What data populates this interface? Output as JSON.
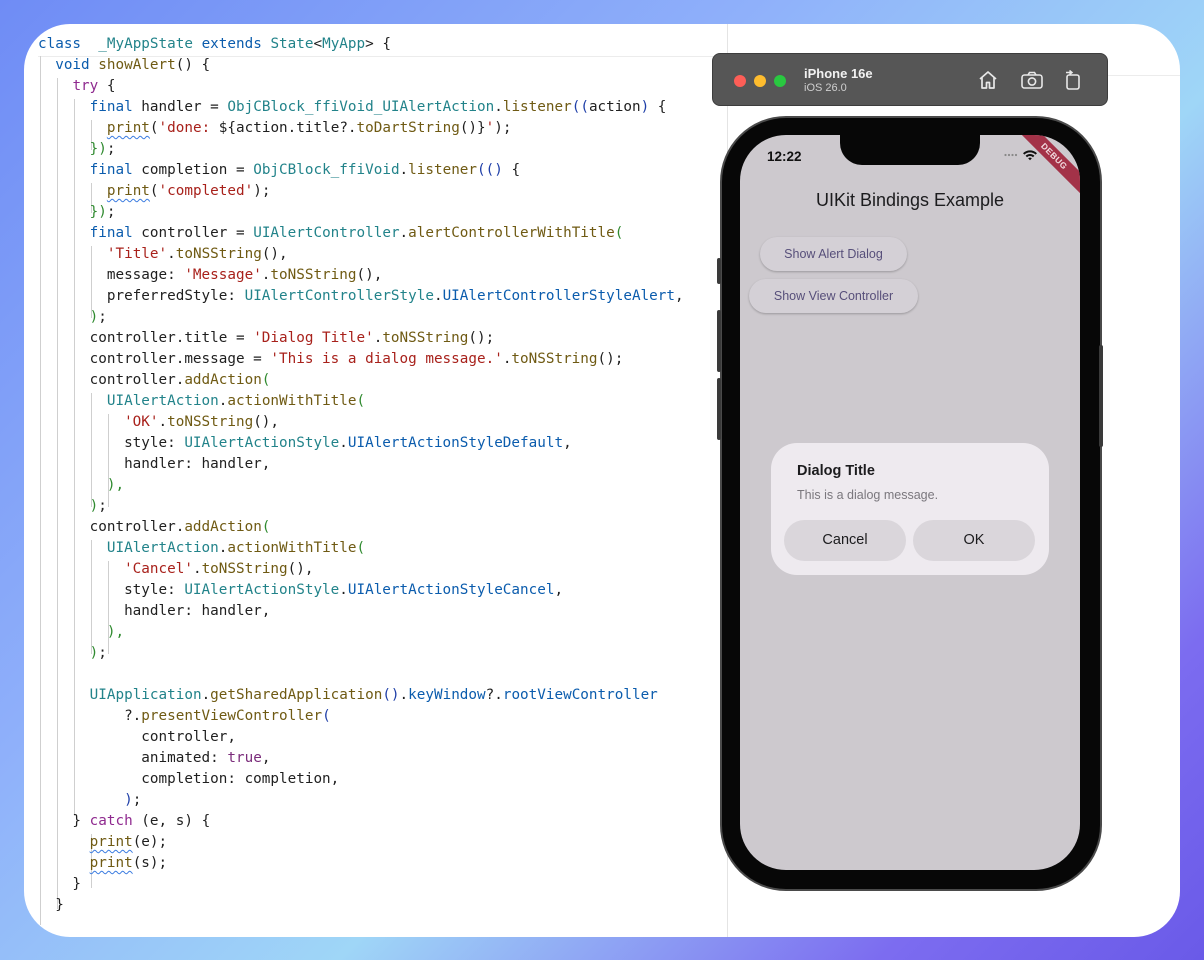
{
  "editor": {
    "lines": [
      [
        [
          "kw2",
          "class"
        ],
        [
          "",
          "  "
        ],
        [
          "ty",
          "_MyAppState"
        ],
        [
          "",
          " "
        ],
        [
          "kw2",
          "extends"
        ],
        [
          "",
          " "
        ],
        [
          "ty",
          "State"
        ],
        [
          "",
          "<"
        ],
        [
          "ty",
          "MyApp"
        ],
        [
          "",
          "> {"
        ]
      ],
      [
        [
          "",
          "  "
        ],
        [
          "kw2",
          "void"
        ],
        [
          "",
          " "
        ],
        [
          "fn",
          "showAlert"
        ],
        [
          "",
          "() {"
        ]
      ],
      [
        [
          "",
          "    "
        ],
        [
          "kw",
          "try"
        ],
        [
          "",
          " {"
        ]
      ],
      [
        [
          "",
          "      "
        ],
        [
          "kw2",
          "final"
        ],
        [
          "",
          " handler = "
        ],
        [
          "ty",
          "ObjCBlock_ffiVoid_UIAlertAction"
        ],
        [
          "",
          "."
        ],
        [
          "fn",
          "listener"
        ],
        [
          "br1",
          "(("
        ],
        [
          "",
          "action"
        ],
        [
          "br1",
          ")"
        ],
        [
          "",
          " {"
        ]
      ],
      [
        [
          "",
          "        "
        ],
        [
          "fn sq",
          "print"
        ],
        [
          "",
          "("
        ],
        [
          "st",
          "'done: "
        ],
        [
          "",
          "${action."
        ],
        [
          "",
          "title"
        ],
        [
          "",
          "?."
        ],
        [
          "fn",
          "toDartString"
        ],
        [
          "",
          "()}"
        ],
        [
          "st",
          "'"
        ],
        [
          "",
          ");"
        ]
      ],
      [
        [
          "",
          "      "
        ],
        [
          "br2",
          "})"
        ],
        [
          "",
          ";"
        ]
      ],
      [
        [
          "",
          "      "
        ],
        [
          "kw2",
          "final"
        ],
        [
          "",
          " completion = "
        ],
        [
          "ty",
          "ObjCBlock_ffiVoid"
        ],
        [
          "",
          "."
        ],
        [
          "fn",
          "listener"
        ],
        [
          "br1",
          "(()"
        ],
        [
          "",
          " {"
        ]
      ],
      [
        [
          "",
          "        "
        ],
        [
          "fn sq",
          "print"
        ],
        [
          "",
          "("
        ],
        [
          "st",
          "'completed'"
        ],
        [
          "",
          ");"
        ]
      ],
      [
        [
          "",
          "      "
        ],
        [
          "br2",
          "})"
        ],
        [
          "",
          ";"
        ]
      ],
      [
        [
          "",
          "      "
        ],
        [
          "kw2",
          "final"
        ],
        [
          "",
          " controller = "
        ],
        [
          "ty",
          "UIAlertController"
        ],
        [
          "",
          "."
        ],
        [
          "fn",
          "alertControllerWithTitle"
        ],
        [
          "br2",
          "("
        ]
      ],
      [
        [
          "",
          "        "
        ],
        [
          "st",
          "'Title'"
        ],
        [
          "",
          "."
        ],
        [
          "fn",
          "toNSString"
        ],
        [
          "",
          "(),"
        ]
      ],
      [
        [
          "",
          "        message: "
        ],
        [
          "st",
          "'Message'"
        ],
        [
          "",
          "."
        ],
        [
          "fn",
          "toNSString"
        ],
        [
          "",
          "(),"
        ]
      ],
      [
        [
          "",
          "        preferredStyle: "
        ],
        [
          "ty",
          "UIAlertControllerStyle"
        ],
        [
          "",
          "."
        ],
        [
          "en",
          "UIAlertControllerStyleAlert"
        ],
        [
          "",
          ","
        ]
      ],
      [
        [
          "",
          "      "
        ],
        [
          "br2",
          ")"
        ],
        [
          "",
          ";"
        ]
      ],
      [
        [
          "",
          "      controller.title = "
        ],
        [
          "st",
          "'Dialog Title'"
        ],
        [
          "",
          "."
        ],
        [
          "fn",
          "toNSString"
        ],
        [
          "",
          "();"
        ]
      ],
      [
        [
          "",
          "      controller.message = "
        ],
        [
          "st",
          "'This is a dialog message.'"
        ],
        [
          "",
          "."
        ],
        [
          "fn",
          "toNSString"
        ],
        [
          "",
          "();"
        ]
      ],
      [
        [
          "",
          "      controller."
        ],
        [
          "fn",
          "addAction"
        ],
        [
          "br2",
          "("
        ]
      ],
      [
        [
          "",
          "        "
        ],
        [
          "ty",
          "UIAlertAction"
        ],
        [
          "",
          "."
        ],
        [
          "fn",
          "actionWithTitle"
        ],
        [
          "br2",
          "("
        ]
      ],
      [
        [
          "",
          "          "
        ],
        [
          "st",
          "'OK'"
        ],
        [
          "",
          "."
        ],
        [
          "fn",
          "toNSString"
        ],
        [
          "",
          "(),"
        ]
      ],
      [
        [
          "",
          "          style: "
        ],
        [
          "ty",
          "UIAlertActionStyle"
        ],
        [
          "",
          "."
        ],
        [
          "en",
          "UIAlertActionStyleDefault"
        ],
        [
          "",
          ","
        ]
      ],
      [
        [
          "",
          "          handler: handler,"
        ]
      ],
      [
        [
          "",
          "        "
        ],
        [
          "br2",
          "),"
        ]
      ],
      [
        [
          "",
          "      "
        ],
        [
          "br2",
          ")"
        ],
        [
          "",
          ";"
        ]
      ],
      [
        [
          "",
          "      controller."
        ],
        [
          "fn",
          "addAction"
        ],
        [
          "br2",
          "("
        ]
      ],
      [
        [
          "",
          "        "
        ],
        [
          "ty",
          "UIAlertAction"
        ],
        [
          "",
          "."
        ],
        [
          "fn",
          "actionWithTitle"
        ],
        [
          "br2",
          "("
        ]
      ],
      [
        [
          "",
          "          "
        ],
        [
          "st",
          "'Cancel'"
        ],
        [
          "",
          "."
        ],
        [
          "fn",
          "toNSString"
        ],
        [
          "",
          "(),"
        ]
      ],
      [
        [
          "",
          "          style: "
        ],
        [
          "ty",
          "UIAlertActionStyle"
        ],
        [
          "",
          "."
        ],
        [
          "en",
          "UIAlertActionStyleCancel"
        ],
        [
          "",
          ","
        ]
      ],
      [
        [
          "",
          "          handler: handler,"
        ]
      ],
      [
        [
          "",
          "        "
        ],
        [
          "br2",
          "),"
        ]
      ],
      [
        [
          "",
          "      "
        ],
        [
          "br2",
          ")"
        ],
        [
          "",
          ";"
        ]
      ],
      [
        [
          "",
          ""
        ]
      ],
      [
        [
          "",
          "      "
        ],
        [
          "ty",
          "UIApplication"
        ],
        [
          "",
          "."
        ],
        [
          "fn",
          "getSharedApplication"
        ],
        [
          "br1",
          "()"
        ],
        [
          "",
          "."
        ],
        [
          "en",
          "keyWindow"
        ],
        [
          "",
          "?."
        ],
        [
          "en",
          "rootViewController"
        ]
      ],
      [
        [
          "",
          "          ?."
        ],
        [
          "fn",
          "presentViewController"
        ],
        [
          "br1",
          "("
        ]
      ],
      [
        [
          "",
          "            controller,"
        ]
      ],
      [
        [
          "",
          "            animated: "
        ],
        [
          "ok",
          "true"
        ],
        [
          "",
          ","
        ]
      ],
      [
        [
          "",
          "            completion: completion,"
        ]
      ],
      [
        [
          "",
          "          "
        ],
        [
          "br1",
          ")"
        ],
        [
          "",
          ";"
        ]
      ],
      [
        [
          "",
          "    } "
        ],
        [
          "kw",
          "catch"
        ],
        [
          "",
          " (e, s) {"
        ]
      ],
      [
        [
          "",
          "      "
        ],
        [
          "fn sq",
          "print"
        ],
        [
          "",
          "(e);"
        ]
      ],
      [
        [
          "",
          "      "
        ],
        [
          "fn sq",
          "print"
        ],
        [
          "",
          "(s);"
        ]
      ],
      [
        [
          "",
          "    }"
        ]
      ],
      [
        [
          "",
          "  }"
        ]
      ]
    ]
  },
  "simulator": {
    "device_name": "iPhone 16e",
    "os_version": "iOS 26.0",
    "status_time": "12:22",
    "debug_banner": "DEBUG",
    "app_title": "UIKit Bindings Example",
    "buttons": {
      "show_alert": "Show Alert Dialog",
      "show_view_controller": "Show View Controller"
    },
    "dialog": {
      "title": "Dialog Title",
      "message": "This is a dialog message.",
      "cancel": "Cancel",
      "ok": "OK"
    }
  }
}
